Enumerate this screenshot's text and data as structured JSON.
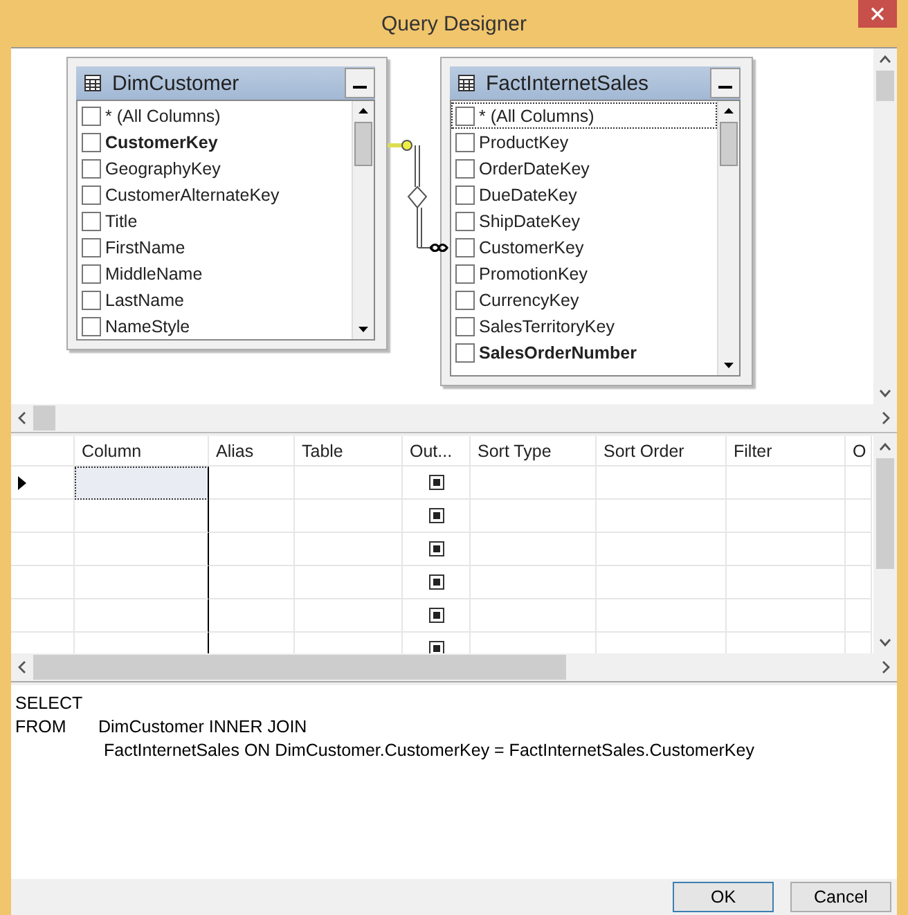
{
  "window": {
    "title": "Query Designer"
  },
  "diagram": {
    "tables": [
      {
        "name": "DimCustomer",
        "columns": [
          {
            "label": "* (All Columns)",
            "checked": false,
            "key": false,
            "focused": false
          },
          {
            "label": "CustomerKey",
            "checked": false,
            "key": true,
            "focused": false
          },
          {
            "label": "GeographyKey",
            "checked": false,
            "key": false,
            "focused": false
          },
          {
            "label": "CustomerAlternateKey",
            "checked": false,
            "key": false,
            "focused": false
          },
          {
            "label": "Title",
            "checked": false,
            "key": false,
            "focused": false
          },
          {
            "label": "FirstName",
            "checked": false,
            "key": false,
            "focused": false
          },
          {
            "label": "MiddleName",
            "checked": false,
            "key": false,
            "focused": false
          },
          {
            "label": "LastName",
            "checked": false,
            "key": false,
            "focused": false
          },
          {
            "label": "NameStyle",
            "checked": false,
            "key": false,
            "focused": false
          }
        ]
      },
      {
        "name": "FactInternetSales",
        "columns": [
          {
            "label": "* (All Columns)",
            "checked": false,
            "key": false,
            "focused": true
          },
          {
            "label": "ProductKey",
            "checked": false,
            "key": false,
            "focused": false
          },
          {
            "label": "OrderDateKey",
            "checked": false,
            "key": false,
            "focused": false
          },
          {
            "label": "DueDateKey",
            "checked": false,
            "key": false,
            "focused": false
          },
          {
            "label": "ShipDateKey",
            "checked": false,
            "key": false,
            "focused": false
          },
          {
            "label": "CustomerKey",
            "checked": false,
            "key": false,
            "focused": false
          },
          {
            "label": "PromotionKey",
            "checked": false,
            "key": false,
            "focused": false
          },
          {
            "label": "CurrencyKey",
            "checked": false,
            "key": false,
            "focused": false
          },
          {
            "label": "SalesTerritoryKey",
            "checked": false,
            "key": false,
            "focused": false
          },
          {
            "label": "SalesOrderNumber",
            "checked": false,
            "key": true,
            "focused": false
          }
        ]
      }
    ]
  },
  "grid": {
    "columns": [
      "Column",
      "Alias",
      "Table",
      "Out...",
      "Sort Type",
      "Sort Order",
      "Filter",
      "O"
    ],
    "rows": [
      {
        "current": true,
        "output": true
      },
      {
        "current": false,
        "output": true
      },
      {
        "current": false,
        "output": true
      },
      {
        "current": false,
        "output": true
      },
      {
        "current": false,
        "output": true
      },
      {
        "current": false,
        "output": true
      }
    ]
  },
  "sql": [
    {
      "keyword": "SELECT"
    },
    {
      "keyword": "FROM",
      "text": "DimCustomer INNER JOIN"
    },
    {
      "text": "FactInternetSales ON DimCustomer.CustomerKey = FactInternetSales.CustomerKey"
    }
  ],
  "buttons": [
    {
      "label": "OK",
      "default": true
    },
    {
      "label": "Cancel",
      "default": false
    }
  ]
}
